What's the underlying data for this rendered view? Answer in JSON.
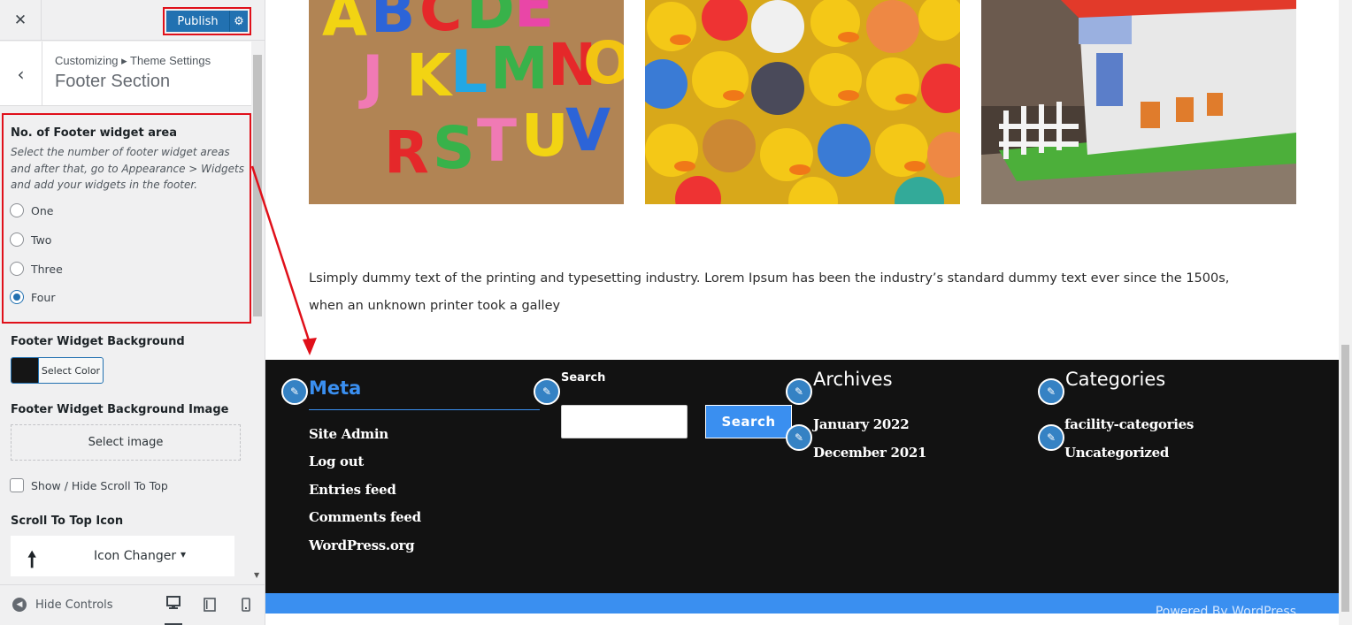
{
  "header": {
    "publish_label": "Publish"
  },
  "section": {
    "breadcrumb": "Customizing ▸ Theme Settings",
    "title": "Footer Section"
  },
  "controls": {
    "widget_area": {
      "title": "No. of Footer widget area",
      "description": "Select the number of footer widget areas and after that, go to Appearance > Widgets and add your widgets in the footer.",
      "options": [
        {
          "label": "One",
          "checked": false
        },
        {
          "label": "Two",
          "checked": false
        },
        {
          "label": "Three",
          "checked": false
        },
        {
          "label": "Four",
          "checked": true
        }
      ]
    },
    "background": {
      "title": "Footer Widget Background",
      "select_color_label": "Select Color",
      "swatch_color": "#151515"
    },
    "background_image": {
      "title": "Footer Widget Background Image",
      "select_image_label": "Select image"
    },
    "scroll_top_toggle": {
      "label": "Show / Hide Scroll To Top",
      "checked": false
    },
    "scroll_top_icon": {
      "title": "Scroll To Top Icon",
      "changer_label": "Icon Changer",
      "icon": "arrow-up-icon"
    }
  },
  "panel_footer": {
    "hide_controls_label": "Hide Controls"
  },
  "preview": {
    "body_text": "Lsimply dummy text of the printing and typesetting industry. Lorem Ipsum has been the industry’s standard dummy text ever since the 1500s, when an unknown printer took a galley",
    "meta": {
      "title": "Meta",
      "links": [
        "Site Admin",
        "Log out",
        "Entries feed",
        "Comments feed",
        "WordPress.org"
      ]
    },
    "search": {
      "label": "Search",
      "button_label": "Search"
    },
    "archives": {
      "title": "Archives",
      "links": [
        "January 2022",
        "December 2021"
      ]
    },
    "categories": {
      "title": "Categories",
      "links": [
        "facility-categories",
        "Uncategorized"
      ]
    },
    "powered_by": "Powered By WordPress"
  },
  "colors": {
    "accent_blue": "#3a8ff0",
    "wp_blue": "#2271b1",
    "highlight_red": "#e0101a",
    "footer_bg": "#121212"
  }
}
